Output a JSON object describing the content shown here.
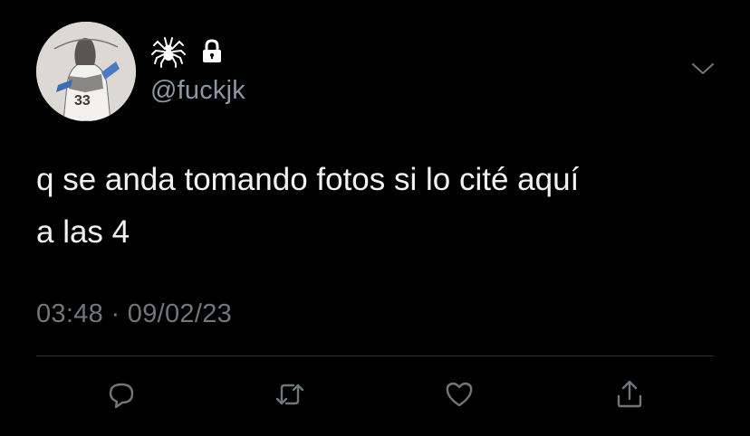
{
  "tweet": {
    "handle": "@fuckjk",
    "display_name_icons": [
      "spider-icon",
      "lock-icon"
    ],
    "text": "q se anda tomando fotos si lo cité aquí\na las 4",
    "time": "03:48",
    "separator": "·",
    "date": "09/02/23"
  },
  "actions": [
    "reply-icon",
    "retweet-icon",
    "like-icon",
    "share-icon"
  ],
  "colors": {
    "background": "#000000",
    "text": "#f2f2f2",
    "secondary": "#71767b",
    "divider": "#2f3336"
  }
}
